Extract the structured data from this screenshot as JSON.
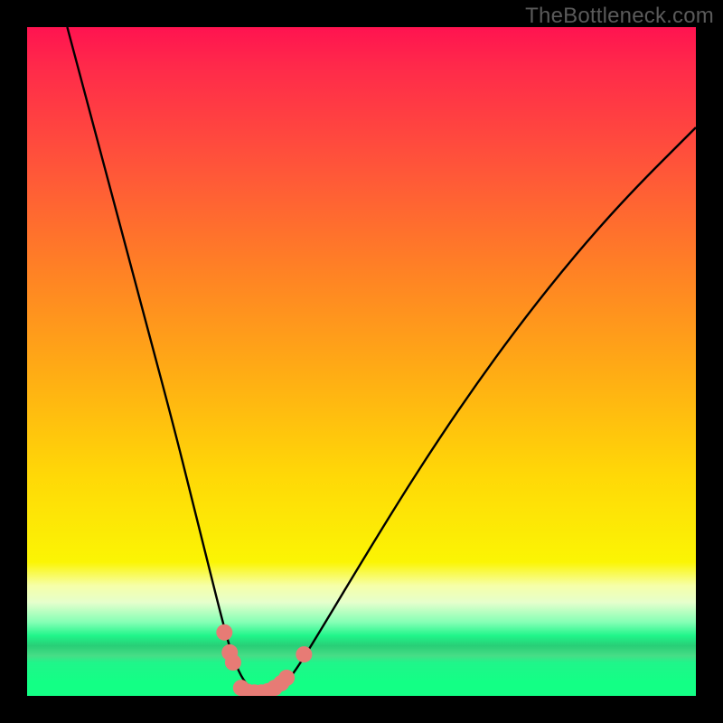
{
  "watermark": "TheBottleneck.com",
  "colors": {
    "frame": "#000000",
    "curve": "#000000",
    "dot": "#e77b75",
    "gradient_top": "#ff1350",
    "gradient_bottom": "#13ff85"
  },
  "chart_data": {
    "type": "line",
    "title": "",
    "xlabel": "",
    "ylabel": "",
    "xlim": [
      0,
      100
    ],
    "ylim": [
      0,
      100
    ],
    "annotations": [],
    "series": [
      {
        "name": "bottleneck-curve",
        "x": [
          6,
          10,
          14,
          18,
          22,
          25,
          27,
          29,
          30.5,
          32,
          33.5,
          35,
          36.5,
          38,
          40,
          44,
          50,
          58,
          66,
          74,
          82,
          90,
          100
        ],
        "y": [
          100,
          85,
          70,
          55,
          40,
          28,
          20,
          12,
          6.5,
          2.8,
          1.0,
          0.4,
          0.5,
          1.3,
          3.5,
          10,
          20,
          33,
          45,
          56,
          66,
          75,
          85
        ]
      }
    ],
    "markers": [
      {
        "x": 29.5,
        "y": 9.5,
        "r": 1.2
      },
      {
        "x": 30.3,
        "y": 6.5,
        "r": 1.2
      },
      {
        "x": 30.8,
        "y": 5.0,
        "r": 1.2
      },
      {
        "x": 32.0,
        "y": 1.2,
        "r": 1.2
      },
      {
        "x": 33.0,
        "y": 0.6,
        "r": 1.2
      },
      {
        "x": 34.0,
        "y": 0.5,
        "r": 1.2
      },
      {
        "x": 35.0,
        "y": 0.5,
        "r": 1.2
      },
      {
        "x": 36.0,
        "y": 0.7,
        "r": 1.2
      },
      {
        "x": 37.0,
        "y": 1.2,
        "r": 1.2
      },
      {
        "x": 38.0,
        "y": 1.9,
        "r": 1.2
      },
      {
        "x": 38.8,
        "y": 2.7,
        "r": 1.2
      },
      {
        "x": 41.4,
        "y": 6.2,
        "r": 1.3
      }
    ]
  }
}
